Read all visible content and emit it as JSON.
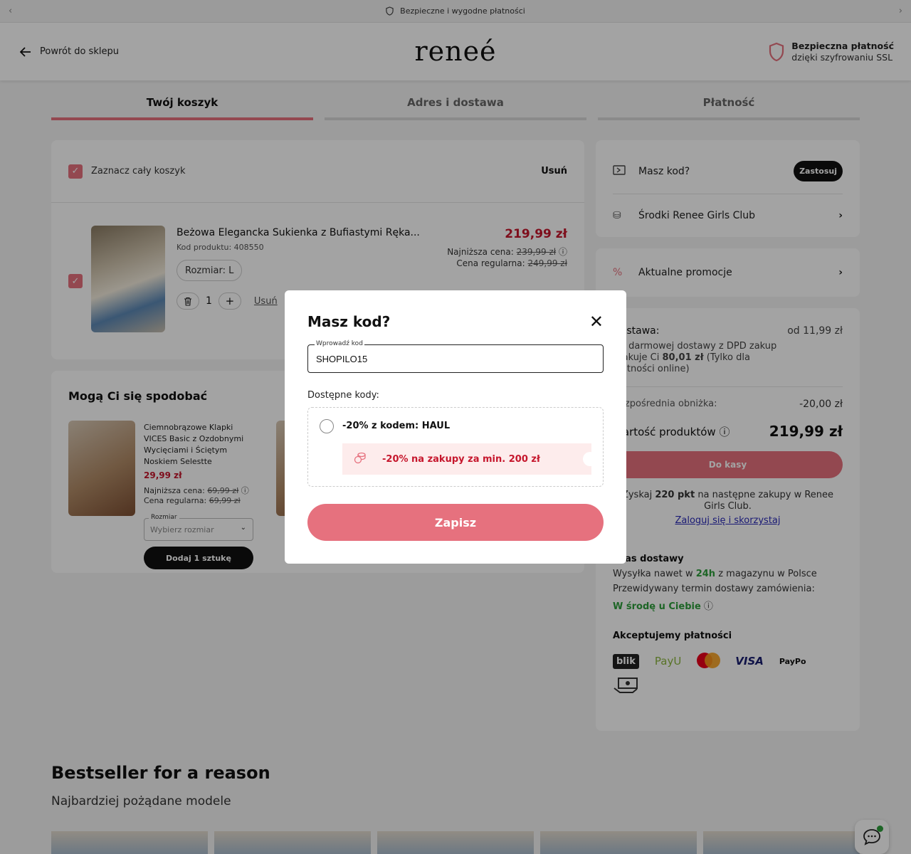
{
  "topbar": {
    "text": "Bezpieczne i wygodne płatności",
    "prev": "‹",
    "next": "›"
  },
  "header": {
    "back": "Powrót do sklepu",
    "logo": "reneé",
    "secure_title": "Bezpieczna płatność",
    "secure_sub": "dzięki szyfrowaniu SSL"
  },
  "steps": [
    {
      "label": "Twój koszyk",
      "active": true
    },
    {
      "label": "Adres i dostawa",
      "active": false
    },
    {
      "label": "Płatność",
      "active": false
    }
  ],
  "cart": {
    "select_all": "Zaznacz cały koszyk",
    "remove": "Usuń",
    "item": {
      "name": "Beżowa Elegancka Sukienka z Bufiastymi Ręka...",
      "code": "Kod produktu: 408550",
      "size": "Rozmiar: L",
      "qty": "1",
      "remove": "Usuń",
      "price": "219,99 zł",
      "lowest_label": "Najniższa cena:",
      "lowest_value": "239,99 zł",
      "regular_label": "Cena regularna:",
      "regular_value": "249,99 zł"
    }
  },
  "reco": {
    "title": "Mogą Ci się spodobać",
    "name": "Ciemnobrązowe Klapki VICES Basic z Ozdobnymi Wycięciami i Ściętym Noskiem Selestte",
    "price": "29,99 zł",
    "lowest_label": "Najniższa cena:",
    "lowest_value": "69,99 zł",
    "regular_label": "Cena regularna:",
    "regular_value": "69,99 zł",
    "size_caption": "Rozmiar",
    "size_placeholder": "Wybierz rozmiar",
    "add": "Dodaj 1 sztukę"
  },
  "side": {
    "code_label": "Masz kod?",
    "apply": "Zastosuj",
    "club": "Środki Renee Girls Club",
    "promos": "Aktualne promocje",
    "delivery_label": "Dostawa:",
    "delivery_value": "od 11,99 zł",
    "free_prefix": "Do darmowej dostawy z DPD zakup brakuje Ci",
    "free_amount": "80,01 zł",
    "free_suffix": "(Tylko dla płatności online)",
    "discount_label": "Bezpośrednia obniżka:",
    "discount_value": "-20,00 zł",
    "total_label": "Wartość produktów",
    "total_value": "219,99 zł",
    "checkout": "Do kasy",
    "points_prefix": "Zyskaj",
    "points_amount": "220 pkt",
    "points_suffix": "na następne zakupy w Renee Girls Club.",
    "points_link": "Zaloguj się i skorzystaj",
    "delivery_time_title": "Czas dostawy",
    "ship_prefix": "Wysyłka nawet w",
    "ship_hours": "24h",
    "ship_suffix": "z magazynu w Polsce",
    "forecast": "Przewidywany termin dostawy zamówienia:",
    "forecast_value": "W środę u Ciebie",
    "payments_title": "Akceptujemy płatności",
    "payments": [
      "blik",
      "PayU",
      "mastercard",
      "VISA",
      "PayPo"
    ]
  },
  "bestseller": {
    "title": "Bestseller for a reason",
    "subtitle": "Najbardziej pożądane modele"
  },
  "modal": {
    "title": "Masz kod?",
    "close": "✕",
    "input_caption": "Wprowadź kod",
    "input_value": "SHOPILO15",
    "available": "Dostępne kody:",
    "code_title": "-20% z kodem: HAUL",
    "code_promo": "-20% na zakupy za min. 200 zł",
    "save": "Zapisz"
  },
  "colors": {
    "accent": "#e6717e",
    "price": "#c6172d",
    "green": "#2e9e3c"
  }
}
